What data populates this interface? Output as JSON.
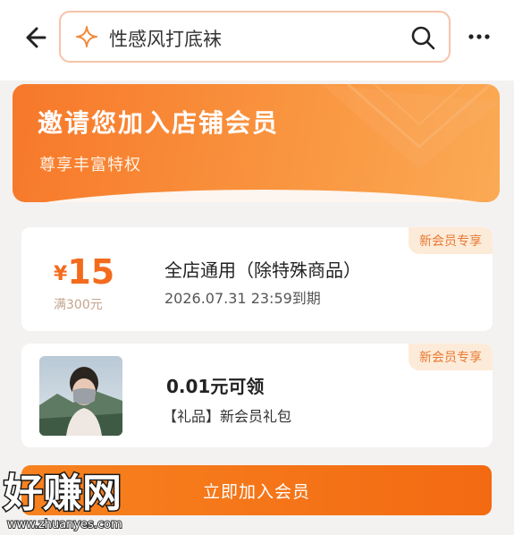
{
  "colors": {
    "accent": "#f36b1c",
    "tag_bg": "#fdebd9",
    "banner_start": "#f7782a"
  },
  "header": {
    "back_icon": "back-arrow-icon",
    "search_query": "性感风打底袜",
    "search_icon": "search-icon",
    "more_icon": "more-icon"
  },
  "banner": {
    "title": "邀请您加入店铺会员",
    "subtitle": "尊享丰富特权"
  },
  "coupon": {
    "tag": "新会员专享",
    "currency": "¥",
    "amount": "15",
    "threshold": "满300元",
    "title": "全店通用（除特殊商品）",
    "expiry": "2026.07.31 23:59到期"
  },
  "gift": {
    "tag": "新会员专享",
    "title": "0.01元可领",
    "subtitle": "【礼品】新会员礼包"
  },
  "join_button": "立即加入会员",
  "watermark": {
    "logo": "好赚网",
    "url": "www.zhuanyes.com"
  }
}
